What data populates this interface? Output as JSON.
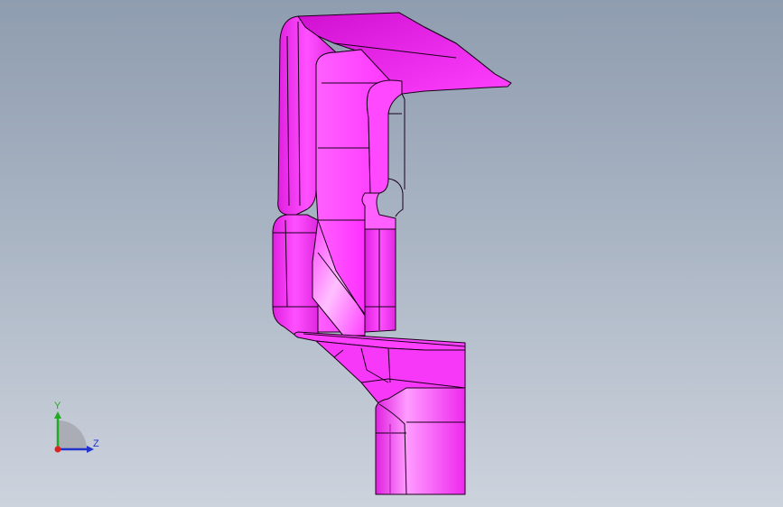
{
  "viewport": {
    "background_top": "#8f9db0",
    "background_bottom": "#cdd3dd"
  },
  "model": {
    "color": "#ff33ff",
    "edge_color": "#1a001a",
    "icon": "3d-part-section-icon"
  },
  "triad": {
    "x_axis_label": "Z",
    "y_axis_label": "Y",
    "colors": {
      "y": "#22aa22",
      "z": "#2233cc",
      "x": "#dd2222"
    }
  }
}
